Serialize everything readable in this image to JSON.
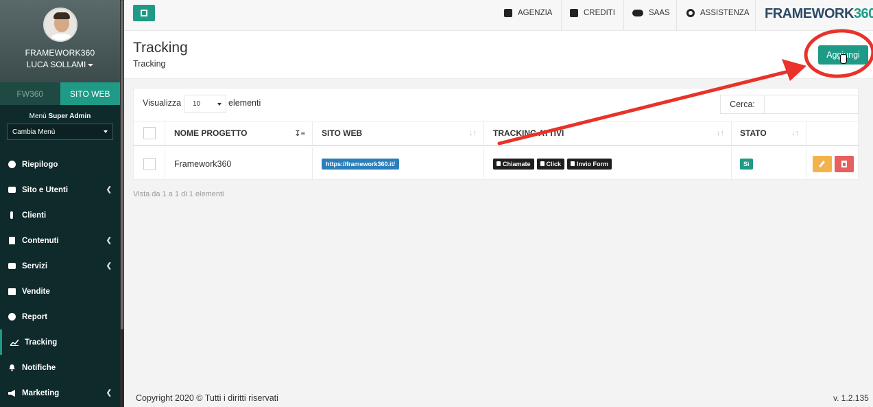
{
  "sidebar": {
    "org": "FRAMEWORK360",
    "user": "LUCA SOLLAMI",
    "tabs": [
      "FW360",
      "SITO WEB"
    ],
    "menu_title_prefix": "Menù",
    "menu_title_bold": "Super Admin",
    "menu_select": "Cambia Menù",
    "items": [
      {
        "label": "Riepilogo",
        "icon": "dashboard-icon"
      },
      {
        "label": "Sito e Utenti",
        "icon": "users-icon"
      },
      {
        "label": "Clienti",
        "icon": "person-icon"
      },
      {
        "label": "Contenuti",
        "icon": "file-icon"
      },
      {
        "label": "Servizi",
        "icon": "briefcase-icon"
      },
      {
        "label": "Vendite",
        "icon": "calculator-icon"
      },
      {
        "label": "Report",
        "icon": "pie-chart-icon"
      },
      {
        "label": "Tracking",
        "icon": "line-chart-icon"
      },
      {
        "label": "Notifiche",
        "icon": "bell-icon"
      },
      {
        "label": "Marketing",
        "icon": "megaphone-icon"
      }
    ]
  },
  "topbar": {
    "agenzia": "AGENZIA",
    "crediti": "CREDITI",
    "saas": "SAAS",
    "assistenza": "ASSISTENZA",
    "brand_main": "FRAMEWORK",
    "brand_num": "360"
  },
  "header": {
    "title": "Tracking",
    "subtitle": "Tracking",
    "add_label": "Aggiungi"
  },
  "table": {
    "show_label": "Visualizza",
    "show_value": "10",
    "show_after": "elementi",
    "search_label": "Cerca:",
    "search_value": "",
    "columns": [
      "NOME PROGETTO",
      "SITO WEB",
      "TRACKING ATTIVI",
      "STATO"
    ],
    "rows": [
      {
        "project": "Framework360",
        "site": "https://framework360.it/",
        "tracking": [
          "Chiamate",
          "Click",
          "Invio Form"
        ],
        "status": "Sì"
      }
    ],
    "info": "Vista da 1 a 1 di 1 elementi"
  },
  "footer": {
    "copyright": "Copyright 2020 © Tutti i diritti riservati",
    "version": "v. 1.2.135"
  },
  "colors": {
    "accent": "#1e9a86",
    "sidebar": "#0f2a2a",
    "annotation": "#e8322a"
  }
}
